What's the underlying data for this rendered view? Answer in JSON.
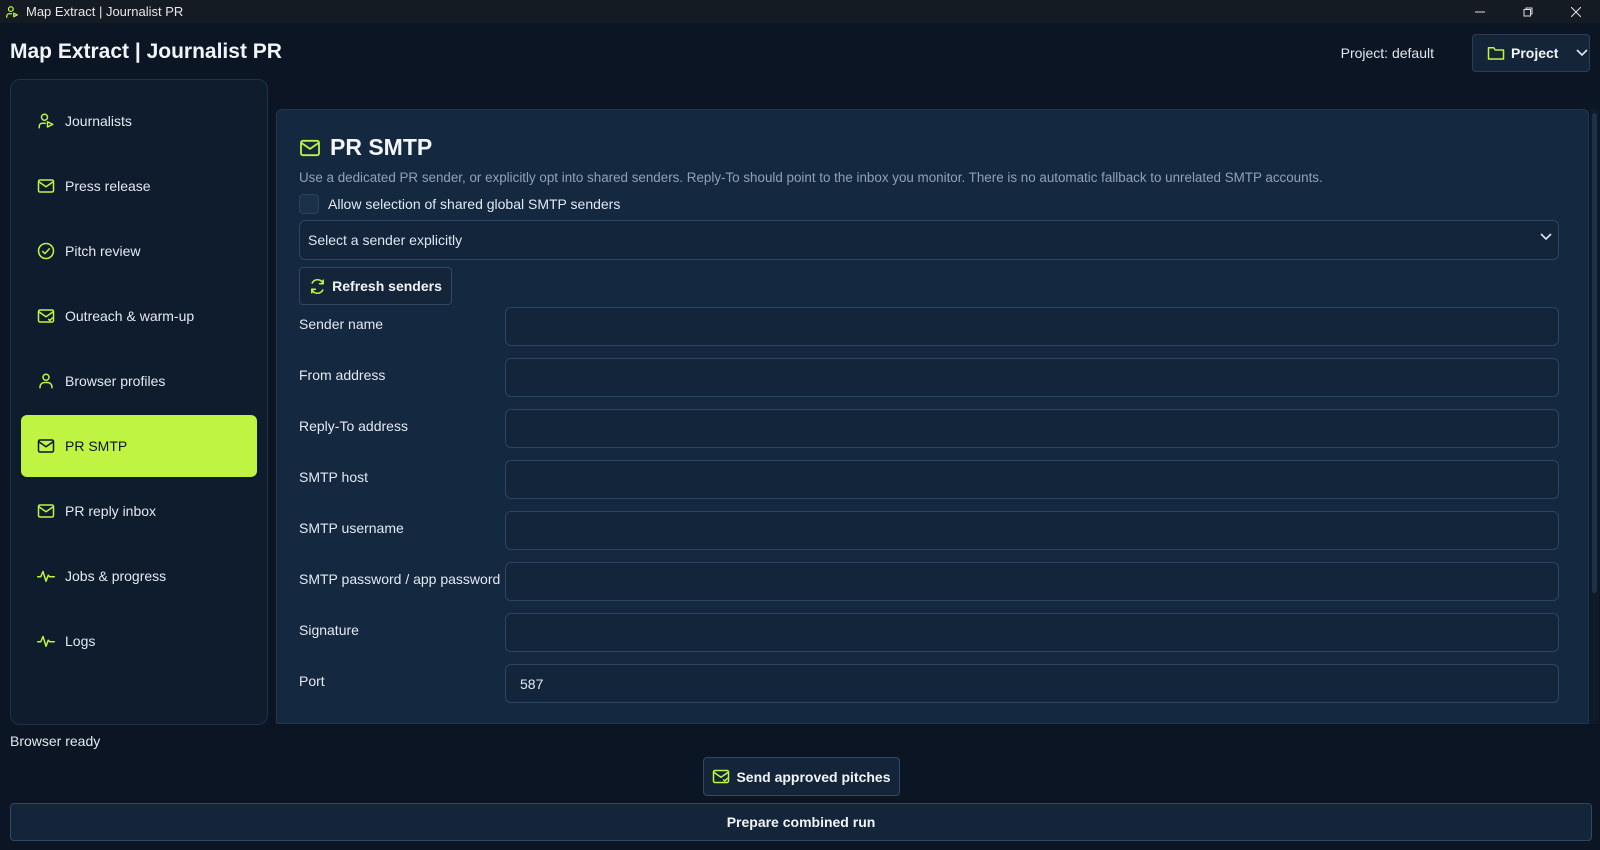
{
  "window": {
    "title": "Map Extract | Journalist PR",
    "controls": [
      "minimize",
      "restore",
      "close"
    ]
  },
  "header": {
    "app_title": "Map Extract | Journalist PR",
    "project_label": "Project: default",
    "project_button": "Project"
  },
  "sidebar": {
    "items": [
      {
        "label": "Journalists",
        "icon": "journalist-icon",
        "active": false
      },
      {
        "label": "Press release",
        "icon": "mail-icon",
        "active": false
      },
      {
        "label": "Pitch review",
        "icon": "check-circle-icon",
        "active": false
      },
      {
        "label": "Outreach & warm-up",
        "icon": "mail-check-icon",
        "active": false
      },
      {
        "label": "Browser profiles",
        "icon": "user-icon",
        "active": false
      },
      {
        "label": "PR SMTP",
        "icon": "mail-icon",
        "active": true
      },
      {
        "label": "PR reply inbox",
        "icon": "mail-icon",
        "active": false
      },
      {
        "label": "Jobs & progress",
        "icon": "activity-icon",
        "active": false
      },
      {
        "label": "Logs",
        "icon": "activity-icon",
        "active": false
      }
    ]
  },
  "panel": {
    "title": "PR SMTP",
    "description": "Use a dedicated PR sender, or explicitly opt into shared senders. Reply-To should point to the inbox you monitor. There is no automatic fallback to unrelated SMTP accounts.",
    "checkbox_label": "Allow selection of shared global SMTP senders",
    "checkbox_checked": false,
    "sender_select": "Select a sender explicitly",
    "refresh_button": "Refresh senders",
    "fields": [
      {
        "label": "Sender name",
        "value": ""
      },
      {
        "label": "From address",
        "value": ""
      },
      {
        "label": "Reply-To address",
        "value": ""
      },
      {
        "label": "SMTP host",
        "value": ""
      },
      {
        "label": "SMTP username",
        "value": ""
      },
      {
        "label": "SMTP password / app password",
        "value": ""
      },
      {
        "label": "Signature",
        "value": ""
      },
      {
        "label": "Port",
        "value": "587"
      }
    ]
  },
  "footer": {
    "status": "Browser ready",
    "send_button": "Send approved pitches",
    "combined_button": "Prepare combined run"
  },
  "colors": {
    "accent": "#bff542",
    "background": "#0b1523",
    "panel": "#142840"
  }
}
